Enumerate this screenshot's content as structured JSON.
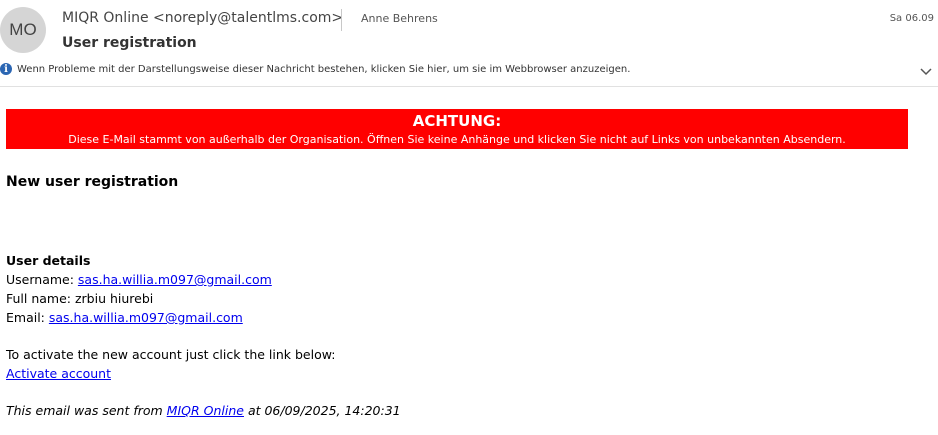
{
  "header": {
    "avatar_initials": "MO",
    "sender": "MIQR Online <noreply@talentlms.com>",
    "recipient": "Anne Behrens",
    "date": "Sa 06.09",
    "subject": "User registration",
    "info_text": "Wenn Probleme mit der Darstellungsweise dieser Nachricht bestehen, klicken Sie hier, um sie im Webbrowser anzuzeigen.",
    "info_icon": "info-icon",
    "expand_icon": "chevron-down-icon"
  },
  "banner": {
    "title": "ACHTUNG:",
    "text": "Diese E-Mail stammt von außerhalb der Organisation. Öffnen Sie keine Anhänge und klicken Sie nicht auf Links von unbekannten Absendern.",
    "color": "#ff0000"
  },
  "body": {
    "heading": "New user registration",
    "details_title": "User details",
    "username_label": "Username: ",
    "username": "sas.ha.willia.m097@gmail.com",
    "fullname_label": "Full name: ",
    "fullname": "zrbiu hiurebi",
    "email_label": "Email: ",
    "email": "sas.ha.willia.m097@gmail.com",
    "activate_text": "To activate the new account just click the link below:",
    "activate_link": "Activate account",
    "footer_prefix": "This email was sent from ",
    "footer_link": "MIQR Online",
    "footer_suffix": " at 06/09/2025, 14:20:31"
  },
  "colors": {
    "link": "#0000ee",
    "avatar_bg": "#d5d5d5",
    "info_icon": "#2b66b3"
  }
}
